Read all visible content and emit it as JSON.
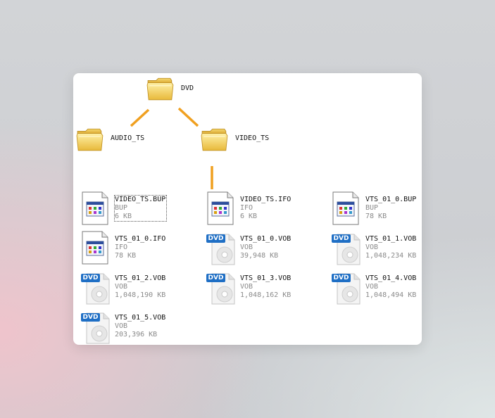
{
  "tree": {
    "root": "DVD",
    "children": [
      "AUDIO_TS",
      "VIDEO_TS"
    ]
  },
  "files": [
    {
      "name": "VIDEO_TS.BUP",
      "type": "BUP",
      "size": "6 KB",
      "icon": "document-icon"
    },
    {
      "name": "VIDEO_TS.IFO",
      "type": "IFO",
      "size": "6 KB",
      "icon": "document-icon"
    },
    {
      "name": "VTS_01_0.BUP",
      "type": "BUP",
      "size": "78 KB",
      "icon": "document-icon"
    },
    {
      "name": "VTS_01_0.IFO",
      "type": "IFO",
      "size": "78 KB",
      "icon": "document-icon"
    },
    {
      "name": "VTS_01_0.VOB",
      "type": "VOB",
      "size": "39,948 KB",
      "icon": "dvd-video-icon"
    },
    {
      "name": "VTS_01_1.VOB",
      "type": "VOB",
      "size": "1,048,234 KB",
      "icon": "dvd-video-icon"
    },
    {
      "name": "VTS_01_2.VOB",
      "type": "VOB",
      "size": "1,048,190 KB",
      "icon": "dvd-video-icon"
    },
    {
      "name": "VTS_01_3.VOB",
      "type": "VOB",
      "size": "1,048,162 KB",
      "icon": "dvd-video-icon"
    },
    {
      "name": "VTS_01_4.VOB",
      "type": "VOB",
      "size": "1,048,494 KB",
      "icon": "dvd-video-icon"
    },
    {
      "name": "VTS_01_5.VOB",
      "type": "VOB",
      "size": "203,396 KB",
      "icon": "dvd-video-icon"
    }
  ],
  "dvd_badge": "DVD",
  "colors": {
    "connector": "#f0a020",
    "folder": "#f5d25c",
    "dvd_badge": "#1f6fc5"
  }
}
